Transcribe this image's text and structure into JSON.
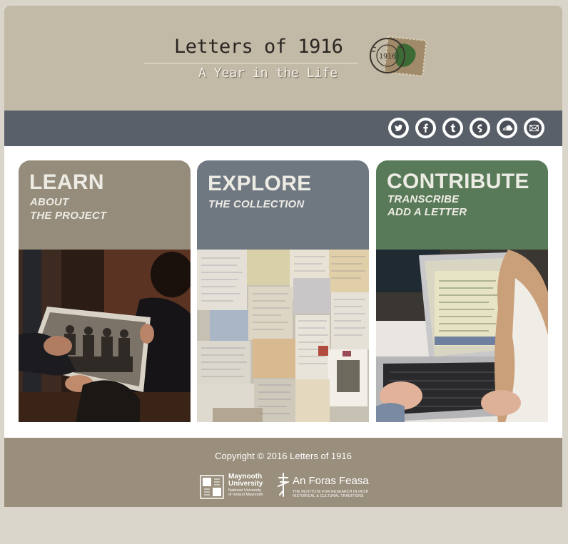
{
  "header": {
    "title": "Letters of 1916",
    "subtitle": "A Year in the Life",
    "stamp_year": "1916",
    "stamp_icon": "postage-stamp-icon"
  },
  "social": [
    {
      "name": "twitter",
      "icon": "twitter-icon"
    },
    {
      "name": "facebook",
      "icon": "facebook-icon"
    },
    {
      "name": "tumblr",
      "icon": "tumblr-icon"
    },
    {
      "name": "storify",
      "icon": "storify-icon"
    },
    {
      "name": "soundcloud",
      "icon": "soundcloud-icon"
    },
    {
      "name": "email",
      "icon": "email-icon"
    }
  ],
  "cards": [
    {
      "title": "LEARN",
      "lines": [
        "ABOUT",
        "THE PROJECT"
      ],
      "color": "#968c7b"
    },
    {
      "title": "EXPLORE",
      "lines": [
        "THE COLLECTION"
      ],
      "color": "#6f7781"
    },
    {
      "title": "CONTRIBUTE",
      "lines": [
        "TRANSCRIBE",
        "ADD A LETTER"
      ],
      "color": "#597a58"
    }
  ],
  "footer": {
    "copyright": "Copyright © 2016 Letters of 1916",
    "maynooth": {
      "name_line1": "Maynooth",
      "name_line2": "University",
      "sub_line1": "National University",
      "sub_line2": "of Ireland Maynooth"
    },
    "foras": {
      "name": "An Foras Feasa",
      "sub_line1": "THE INSTITUTE FOR RESEARCH IN IRISH",
      "sub_line2": "HISTORICAL & CULTURAL TRADITIONS"
    }
  },
  "colors": {
    "page_bg": "#d9d5ca",
    "header_bg": "#c2b9a7",
    "social_bar": "#59606a",
    "footer_bg": "#9a8e7c"
  }
}
